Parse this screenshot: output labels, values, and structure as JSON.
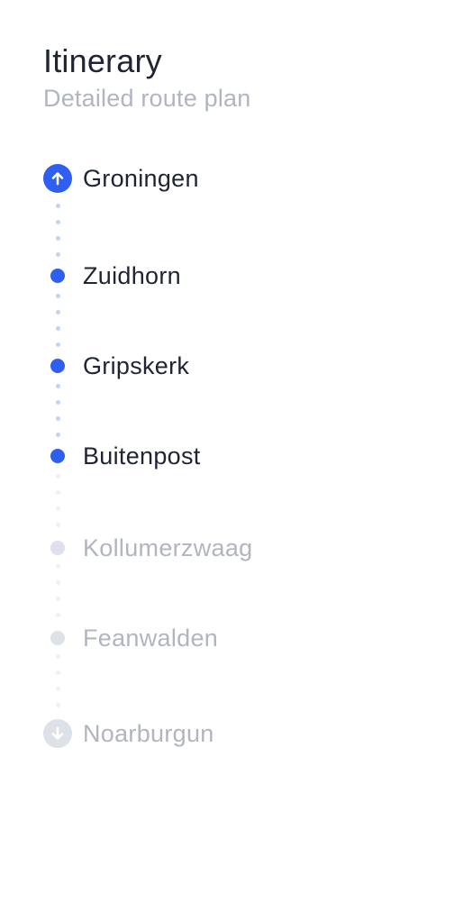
{
  "header": {
    "title": "Itinerary",
    "subtitle": "Detailed route plan"
  },
  "colors": {
    "active": "#2f5ff0",
    "active_connector": "#c4d3f5",
    "inactive": "#dde1e8",
    "inactive_connector": "#eef0f4",
    "text_active": "#1e2433",
    "text_inactive": "#b0b5c0"
  },
  "stops": [
    {
      "name": "Groningen",
      "status": "completed",
      "icon": "arrow-up-icon"
    },
    {
      "name": "Zuidhorn",
      "status": "completed",
      "icon": "dot-icon"
    },
    {
      "name": "Gripskerk",
      "status": "completed",
      "icon": "dot-icon"
    },
    {
      "name": "Buitenpost",
      "status": "completed",
      "icon": "dot-icon"
    },
    {
      "name": "Kollumerzwaag",
      "status": "upcoming",
      "icon": "dot-icon"
    },
    {
      "name": "Feanwalden",
      "status": "upcoming",
      "icon": "dot-icon"
    },
    {
      "name": "Noarburgun",
      "status": "upcoming",
      "icon": "arrow-down-icon"
    }
  ]
}
